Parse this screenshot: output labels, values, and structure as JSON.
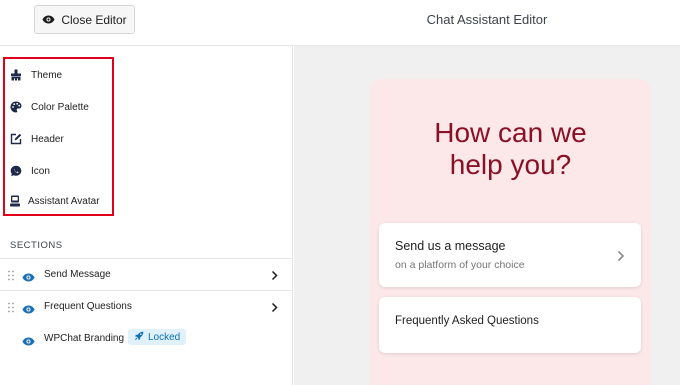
{
  "topbar": {
    "close_label": "Close Editor",
    "title": "Chat Assistant Editor"
  },
  "sidebar": {
    "menu": [
      {
        "label": "Theme",
        "icon": "brush-icon"
      },
      {
        "label": "Color Palette",
        "icon": "palette-icon"
      },
      {
        "label": "Header",
        "icon": "edit-icon"
      },
      {
        "label": "Icon",
        "icon": "chat-icon"
      },
      {
        "label": "Assistant Avatar",
        "icon": "avatar-icon"
      }
    ],
    "sections_label": "SECTIONS",
    "sections": [
      {
        "label": "Send Message",
        "has_chevron": true
      },
      {
        "label": "Frequent Questions",
        "has_chevron": true
      },
      {
        "label": "WPChat Branding",
        "badge": "Locked"
      }
    ]
  },
  "preview": {
    "heading_line1": "How can we",
    "heading_line2": "help you?",
    "card1_title": "Send us a message",
    "card1_subtitle": "on a platform of your choice",
    "card2_title": "Frequently Asked Questions"
  },
  "colors": {
    "accent": "#8a1026",
    "card_bg": "#fce8e8",
    "highlight_border": "#e0001a",
    "badge_bg": "#e0f1fb",
    "badge_text": "#0a6fb4"
  }
}
